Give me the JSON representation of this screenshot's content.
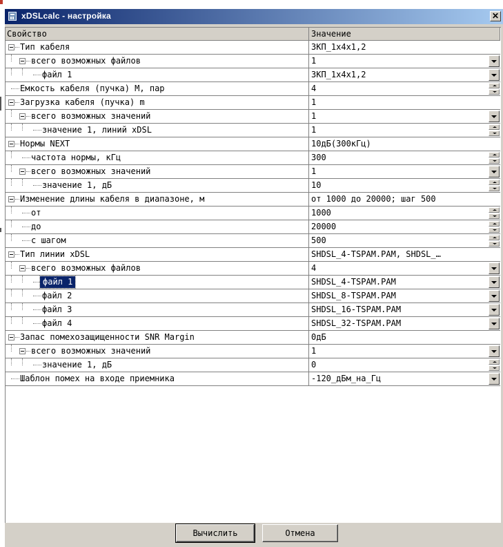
{
  "window": {
    "title": "xDSLcalc - настройка",
    "close_glyph": "✕",
    "icon": "calculator-icon"
  },
  "table": {
    "headers": {
      "property": "Свойство",
      "value": "Значение"
    },
    "rows": [
      {
        "label": "Тип кабеля",
        "value": "ЗКП_1х4х1,2",
        "control": "none",
        "level": 0,
        "expander": true
      },
      {
        "label": "всего возможных файлов",
        "value": "1",
        "control": "dropdown",
        "level": 1,
        "expander": true
      },
      {
        "label": "файл 1",
        "value": "ЗКП_1х4х1,2",
        "control": "dropdown",
        "level": 2,
        "expander": false
      },
      {
        "label": "Емкость кабеля (пучка) М, пар",
        "value": "4",
        "control": "spin",
        "level": 0,
        "expander": false
      },
      {
        "label": "Загрузка кабеля (пучка) m",
        "value": "1",
        "control": "none",
        "level": 0,
        "expander": true
      },
      {
        "label": "всего возможных значений",
        "value": "1",
        "control": "dropdown",
        "level": 1,
        "expander": true
      },
      {
        "label": "значение 1, линий xDSL",
        "value": "1",
        "control": "spin",
        "level": 2,
        "expander": false
      },
      {
        "label": "Нормы NEXT",
        "value": "10дБ(300кГц)",
        "control": "none",
        "level": 0,
        "expander": true
      },
      {
        "label": "частота нормы, кГц",
        "value": "300",
        "control": "spin",
        "level": 1,
        "expander": false
      },
      {
        "label": "всего возможных значений",
        "value": "1",
        "control": "dropdown",
        "level": 1,
        "expander": true
      },
      {
        "label": "значение 1, дБ",
        "value": "10",
        "control": "spin",
        "level": 2,
        "expander": false
      },
      {
        "label": "Изменение длины кабеля в диапазоне, м",
        "value": "от 1000 до 20000; шаг 500",
        "control": "none",
        "level": 0,
        "expander": true
      },
      {
        "label": "от",
        "value": "1000",
        "control": "spin",
        "level": 1,
        "expander": false
      },
      {
        "label": "до",
        "value": "20000",
        "control": "spin",
        "level": 1,
        "expander": false
      },
      {
        "label": "с шагом",
        "value": "500",
        "control": "spin",
        "level": 1,
        "expander": false
      },
      {
        "label": "Тип линии xDSL",
        "value": "SHDSL_4-TSPAM.PAM, SHDSL_…",
        "control": "none",
        "level": 0,
        "expander": true
      },
      {
        "label": "всего возможных файлов",
        "value": "4",
        "control": "dropdown",
        "level": 1,
        "expander": true
      },
      {
        "label": "файл 1",
        "value": "SHDSL_4-TSPAM.PAM",
        "control": "dropdown",
        "level": 2,
        "expander": false,
        "selected": true
      },
      {
        "label": "файл 2",
        "value": "SHDSL_8-TSPAM.PAM",
        "control": "dropdown",
        "level": 2,
        "expander": false
      },
      {
        "label": "файл 3",
        "value": "SHDSL_16-TSPAM.PAM",
        "control": "dropdown",
        "level": 2,
        "expander": false
      },
      {
        "label": "файл 4",
        "value": "SHDSL_32-TSPAM.PAM",
        "control": "dropdown",
        "level": 2,
        "expander": false
      },
      {
        "label": "Запас помехозащищенности SNR Margin",
        "value": "0дБ",
        "control": "none",
        "level": 0,
        "expander": true
      },
      {
        "label": "всего возможных значений",
        "value": "1",
        "control": "dropdown",
        "level": 1,
        "expander": true
      },
      {
        "label": "значение 1, дБ",
        "value": "0",
        "control": "spin",
        "level": 2,
        "expander": false
      },
      {
        "label": "Шаблон помех на входе приемника",
        "value": "-120_дБм_на_Гц",
        "control": "dropdown",
        "level": 0,
        "expander": false
      }
    ]
  },
  "buttons": {
    "calculate": "Вычислить",
    "cancel": "Отмена"
  },
  "colors": {
    "selection": "#0a246a",
    "face": "#d4d0c8"
  }
}
